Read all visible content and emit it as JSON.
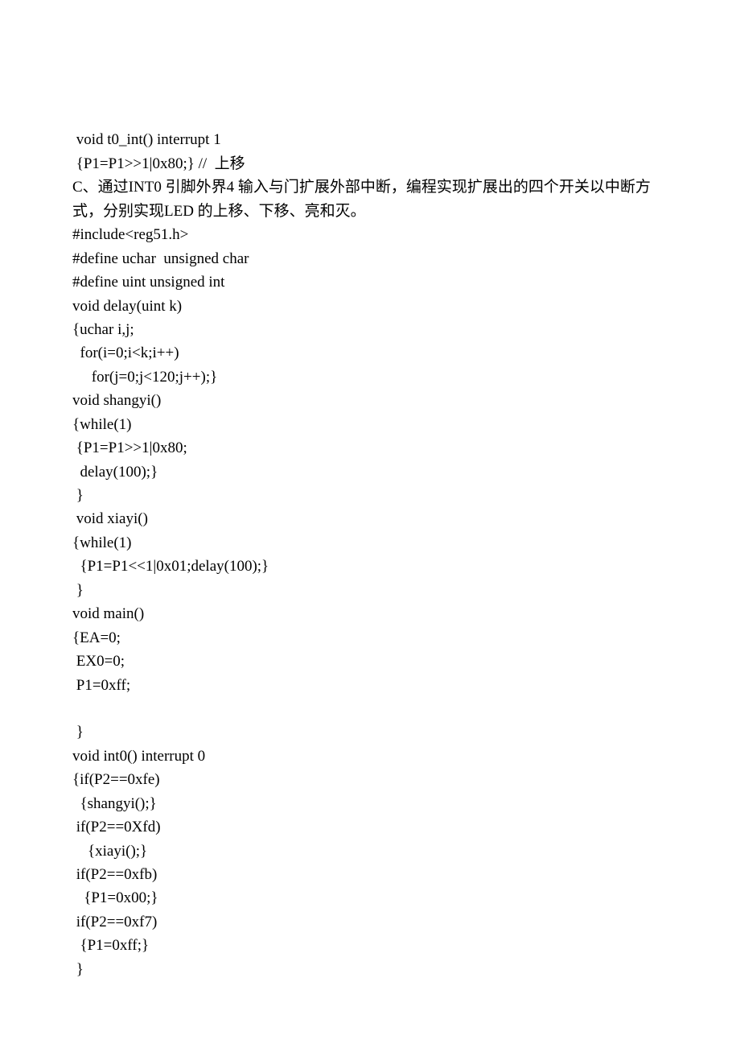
{
  "lines": [
    " void t0_int() interrupt 1",
    " {P1=P1>>1|0x80;} //  上移",
    "C、通过INT0 引脚外界4 输入与门扩展外部中断，编程实现扩展出的四个开关以中断方式，分别实现LED 的上移、下移、亮和灭。",
    "#include<reg51.h>",
    "#define uchar  unsigned char",
    "#define uint unsigned int",
    "void delay(uint k)",
    "{uchar i,j;",
    "  for(i=0;i<k;i++)",
    "     for(j=0;j<120;j++);}",
    "void shangyi()",
    "{while(1)",
    " {P1=P1>>1|0x80;",
    "  delay(100);}",
    " }",
    " void xiayi()",
    "{while(1)",
    "  {P1=P1<<1|0x01;delay(100);}",
    " }",
    "void main()",
    "{EA=0;",
    " EX0=0;",
    " P1=0xff;",
    "",
    " }",
    "void int0() interrupt 0",
    "{if(P2==0xfe)",
    "  {shangyi();}",
    " if(P2==0Xfd)",
    "    {xiayi();}",
    " if(P2==0xfb)",
    "   {P1=0x00;}",
    " if(P2==0xf7)",
    "  {P1=0xff;}",
    " }"
  ]
}
